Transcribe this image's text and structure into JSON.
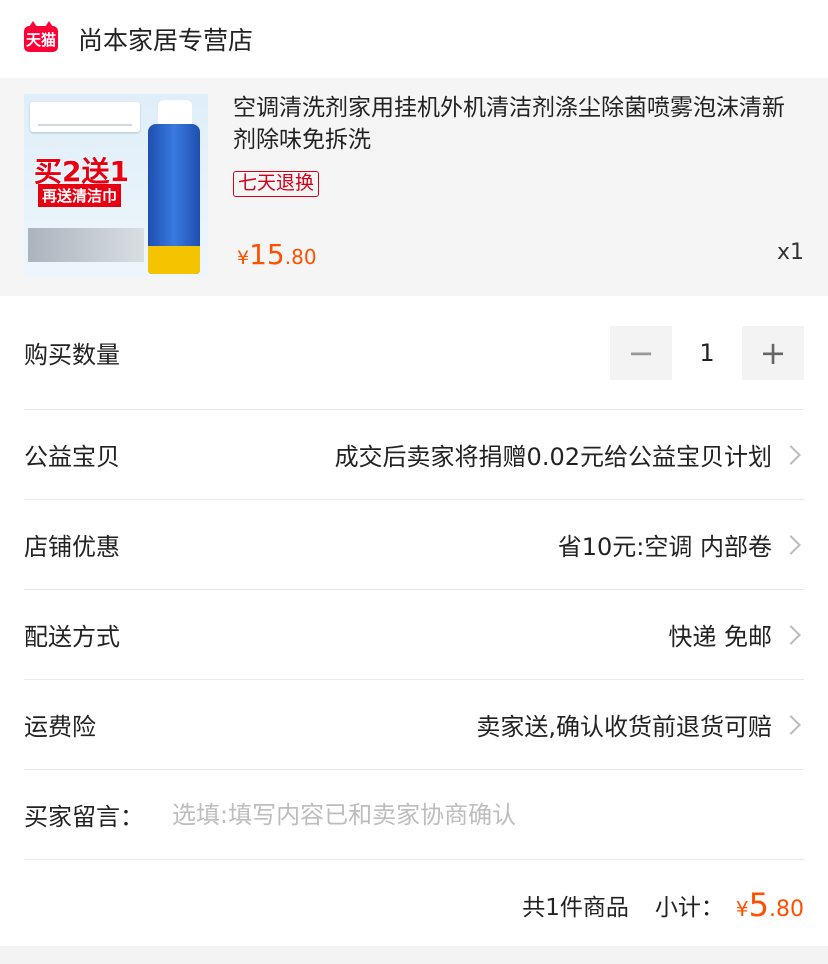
{
  "store": {
    "logo_text": "天猫",
    "name": "尚本家居专营店"
  },
  "product": {
    "title": "空调清洗剂家用挂机外机清洁剂涤尘除菌喷雾泡沫清新剂除味免拆洗",
    "tag": "七天退换",
    "price_symbol": "¥",
    "price_int": "15",
    "price_dec": ".80",
    "quantity_label": "x1",
    "image_text": {
      "promo": "买2送1",
      "promo2": "再送清洁巾"
    }
  },
  "rows": {
    "quantity": {
      "label": "购买数量",
      "minus": "−",
      "value": "1",
      "plus": "+"
    },
    "charity": {
      "label": "公益宝贝",
      "value": "成交后卖家将捐赠0.02元给公益宝贝计划"
    },
    "discount": {
      "label": "店铺优惠",
      "value": "省10元:空调 内部卷"
    },
    "shipping": {
      "label": "配送方式",
      "value": "快递 免邮"
    },
    "insurance": {
      "label": "运费险",
      "value": "卖家送,确认收货前退货可赔"
    },
    "message": {
      "label": "买家留言：",
      "placeholder": "选填:填写内容已和卖家协商确认"
    }
  },
  "summary": {
    "count": "共1件商品",
    "subtotal_label": "小计：",
    "symbol": "¥",
    "int": "5",
    "dec": ".80"
  },
  "colors": {
    "brand": "#ff0036",
    "price": "#ff5000",
    "tag": "#d4001a"
  }
}
